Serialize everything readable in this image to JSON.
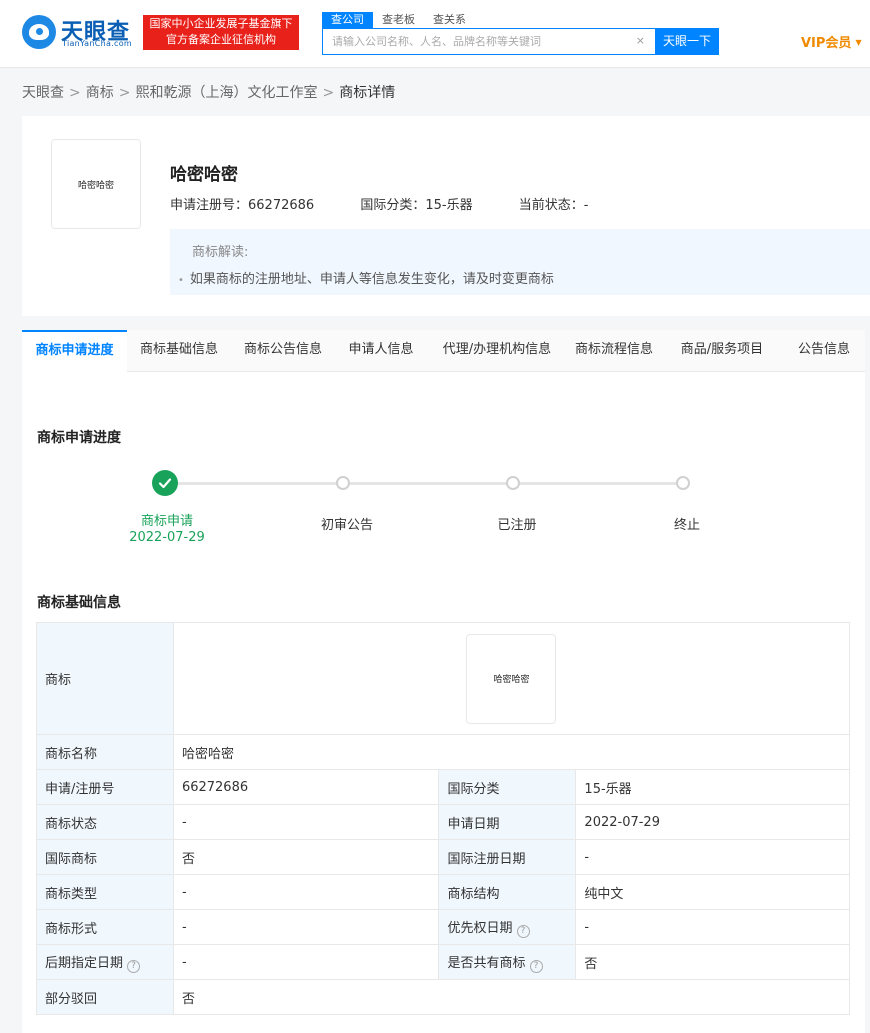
{
  "header": {
    "logo_cn": "天眼查",
    "logo_en": "TianYanCha.com",
    "badge_line1": "国家中小企业发展子基金旗下",
    "badge_line2": "官方备案企业征信机构",
    "search_tabs": [
      "查公司",
      "查老板",
      "查关系"
    ],
    "search_placeholder": "请输入公司名称、人名、品牌名称等关键词",
    "search_button": "天眼一下",
    "vip_label": "VIP会员"
  },
  "breadcrumb": [
    "天眼查",
    "商标",
    "熙和乾源（上海）文化工作室",
    "商标详情"
  ],
  "trademark": {
    "image_text": "哈密哈密",
    "name": "哈密哈密",
    "reg_no_label": "申请注册号：",
    "reg_no": "66272686",
    "class_label": "国际分类：",
    "class_value": "15-乐器",
    "status_label": "当前状态：",
    "status_value": "-",
    "note_title": "商标解读:",
    "note_item": "如果商标的注册地址、申请人等信息发生变化，请及时变更商标"
  },
  "tabs": [
    "商标申请进度",
    "商标基础信息",
    "商标公告信息",
    "申请人信息",
    "代理/办理机构信息",
    "商标流程信息",
    "商品/服务项目",
    "公告信息"
  ],
  "progress": {
    "title": "商标申请进度",
    "steps": [
      {
        "label": "商标申请",
        "date": "2022-07-29",
        "done": true
      },
      {
        "label": "初审公告"
      },
      {
        "label": "已注册"
      },
      {
        "label": "终止"
      }
    ]
  },
  "basic_info": {
    "title": "商标基础信息",
    "image_label": "商标",
    "image_text": "哈密哈密",
    "rows": [
      {
        "l1": "商标名称",
        "v1": "哈密哈密"
      },
      {
        "l1": "申请/注册号",
        "v1": "66272686",
        "l2": "国际分类",
        "v2": "15-乐器"
      },
      {
        "l1": "商标状态",
        "v1": "-",
        "l2": "申请日期",
        "v2": "2022-07-29"
      },
      {
        "l1": "国际商标",
        "v1": "否",
        "l2": "国际注册日期",
        "v2": "-"
      },
      {
        "l1": "商标类型",
        "v1": "-",
        "l2": "商标结构",
        "v2": "纯中文"
      },
      {
        "l1": "商标形式",
        "v1": "-",
        "l2": "优先权日期",
        "v2": "-"
      },
      {
        "l1": "后期指定日期",
        "v1": "-",
        "l2": "是否共有商标",
        "v2": "否"
      },
      {
        "l1": "部分驳回",
        "v1": "否"
      }
    ]
  },
  "colors": {
    "brand_blue": "#0084ff",
    "badge_red": "#e8211b",
    "vip_orange": "#f08a00",
    "success_green": "#19a35a"
  }
}
